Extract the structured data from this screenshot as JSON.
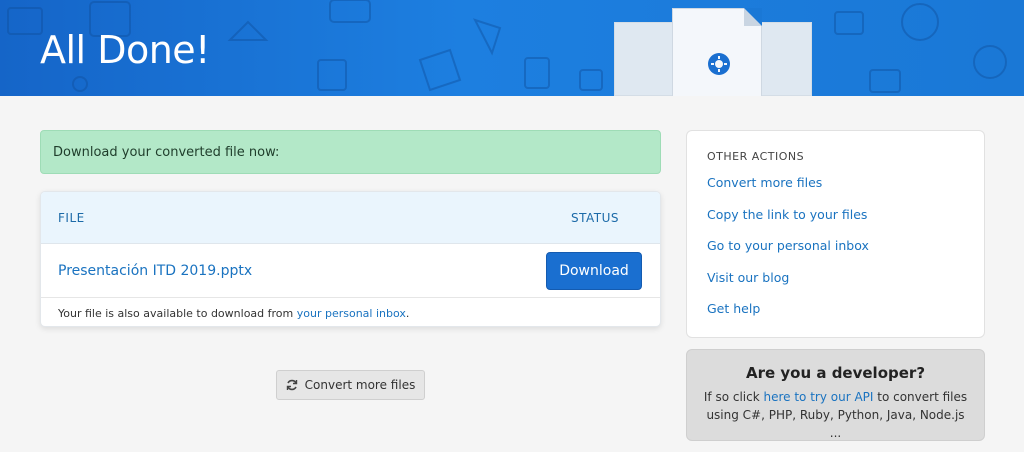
{
  "banner": {
    "title": "All Done!"
  },
  "alert": {
    "text": "Download your converted file now:"
  },
  "file_table": {
    "col_file": "FILE",
    "col_status": "STATUS",
    "file_name": "Presentación ITD 2019.pptx",
    "download_label": "Download",
    "footer_prefix": "Your file is also available to download from ",
    "footer_link": "your personal inbox",
    "footer_suffix": "."
  },
  "convert_button": {
    "label": "Convert more files"
  },
  "other_actions": {
    "title": "OTHER ACTIONS",
    "items": [
      "Convert more files",
      "Copy the link to your files",
      "Go to your personal inbox",
      "Visit our blog",
      "Get help"
    ]
  },
  "developer": {
    "title": "Are you a developer?",
    "text_prefix": "If so click ",
    "link": "here to try our API",
    "text_suffix": " to convert files using C#, PHP, Ruby, Python, Java, Node.js ..."
  },
  "colors": {
    "banner": "#1a78d6",
    "accent": "#1a6fd0",
    "alert_bg": "#b3e8c8",
    "link": "#1a73c0"
  }
}
